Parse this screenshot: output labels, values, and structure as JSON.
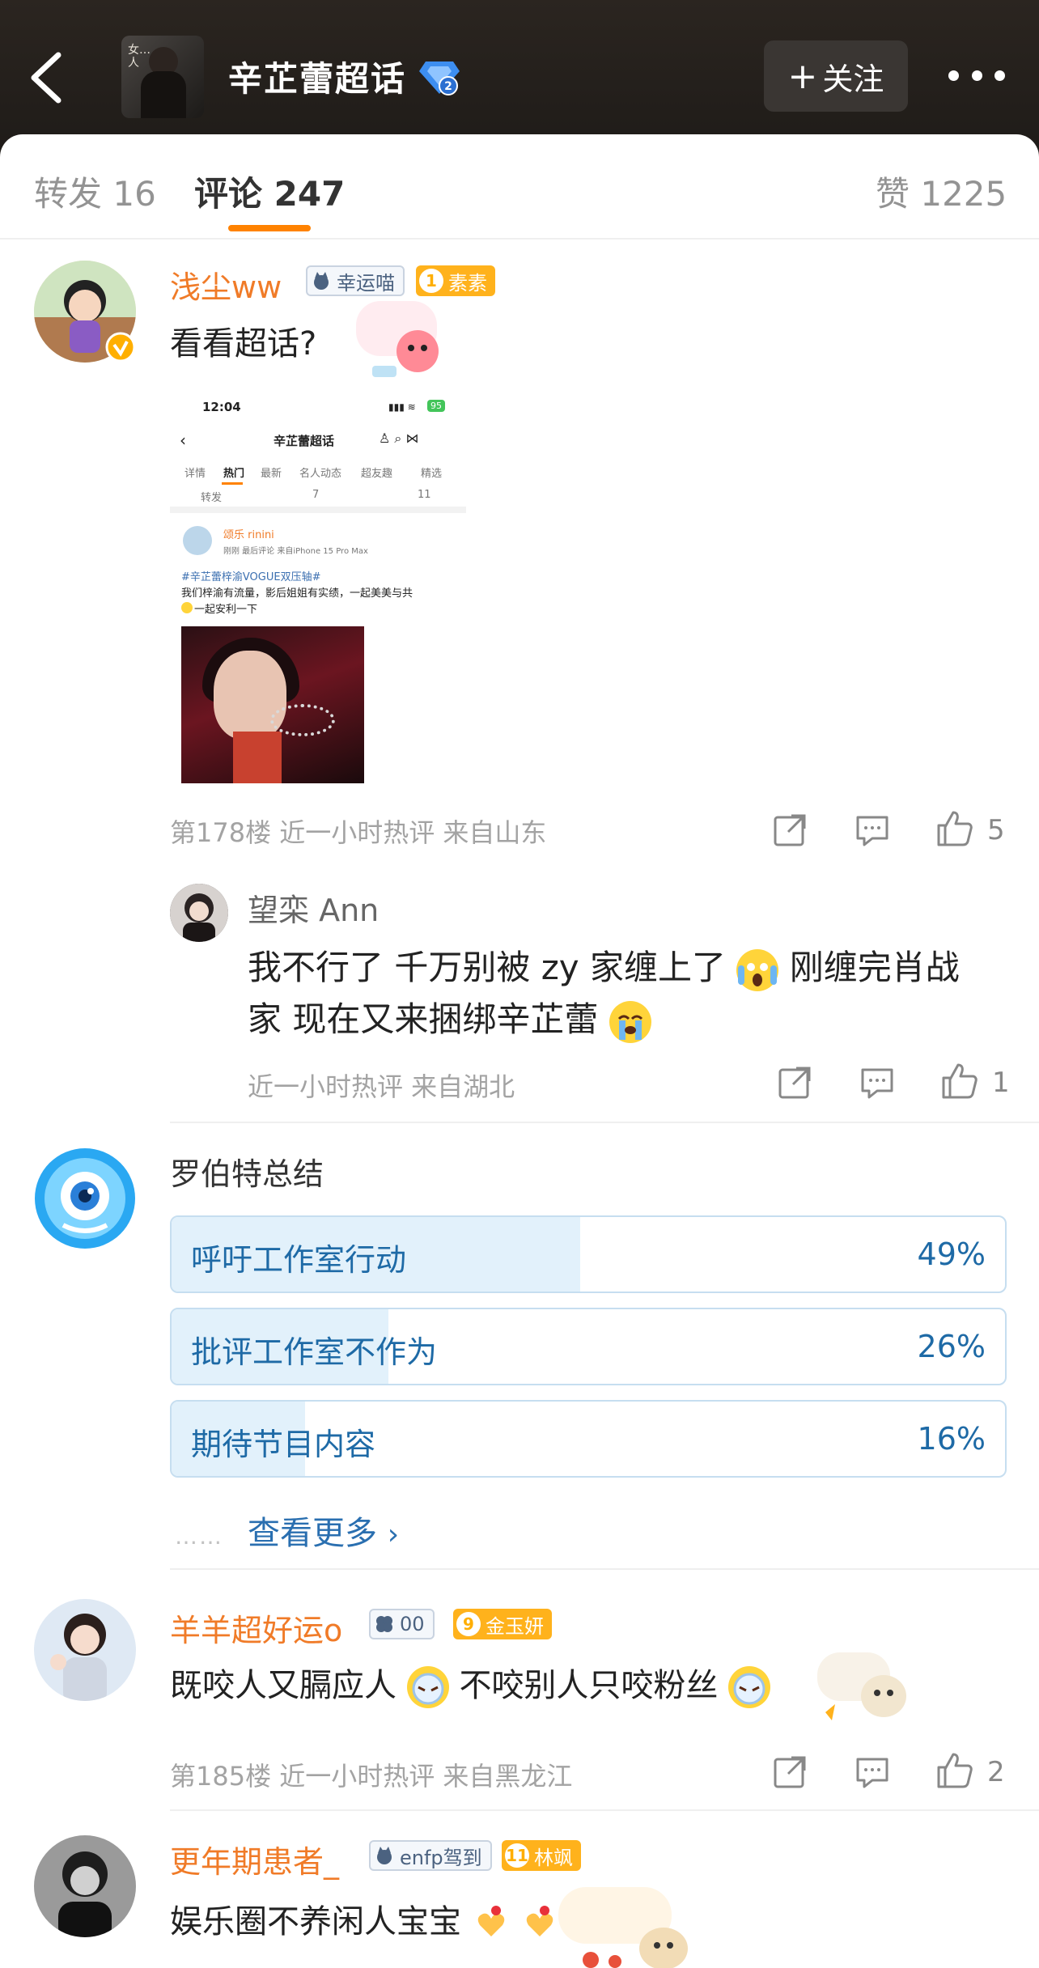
{
  "header": {
    "title": "辛芷蕾超话",
    "follow_label": "关注",
    "avatar_caption": "女…人"
  },
  "tabs": [
    {
      "label": "转发 16"
    },
    {
      "label": "评论 247"
    },
    {
      "label": "赞 1225"
    }
  ],
  "comment1": {
    "username": "浅尘ww",
    "badge1": "幸运喵",
    "badge2_level": "1",
    "badge2": "素素",
    "text": "看看超话?",
    "meta": "第178楼  近一小时热评  来自山东",
    "likes": "5",
    "screenshot": {
      "time": "12:04",
      "battery": "95",
      "title": "辛芷蕾超话",
      "tabs": [
        "详情",
        "热门",
        "最新",
        "名人动态",
        "超友趣",
        "精选"
      ],
      "actions": [
        "转发",
        "7",
        "11"
      ],
      "poster": "颂乐 rinini",
      "poster_meta": "刚刚 最后评论  来自iPhone 15 Pro Max",
      "line1": "#辛芷蕾梓渝VOGUE双压轴#",
      "line2": "我们梓渝有流量，影后姐姐有实绩，一起美美与共",
      "line3": "一起安利一下"
    },
    "reply": {
      "username": "望栾 Ann",
      "text_line1a": "我不行了  千万别被 zy 家缠上了",
      "text_line1b": "刚缠完肖战",
      "text_line2": "家  现在又来捆绑辛芷蕾",
      "meta": "近一小时热评  来自湖北",
      "likes": "1"
    }
  },
  "poll": {
    "title": "罗伯特总结",
    "options": [
      {
        "label": "呼吁工作室行动",
        "pct": "49%",
        "value": 49
      },
      {
        "label": "批评工作室不作为",
        "pct": "26%",
        "value": 26
      },
      {
        "label": "期待节目内容",
        "pct": "16%",
        "value": 16
      }
    ],
    "see_more": "查看更多",
    "dots": "……"
  },
  "comment2": {
    "username": "羊羊超好运o",
    "badge1": "00",
    "badge2_level": "9",
    "badge2": "金玉妍",
    "text_a": "既咬人又膈应人",
    "text_b": "不咬别人只咬粉丝",
    "meta": "第185楼  近一小时热评  来自黑龙江",
    "likes": "2"
  },
  "comment3": {
    "username": "更年期患者_",
    "badge1": "enfp驾到",
    "badge2_level": "11",
    "badge2": "林飒",
    "text": "娱乐圈不养闲人宝宝"
  },
  "colors": {
    "accent": "#ff8200",
    "username": "#f07b28",
    "poll_text": "#1e6aa6",
    "poll_fill": "#e2f1fb"
  }
}
